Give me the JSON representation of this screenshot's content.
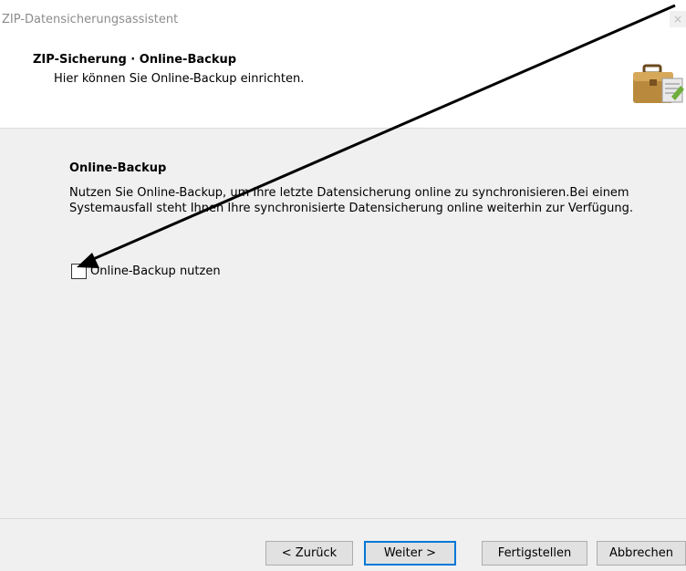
{
  "window": {
    "title": "ZIP-Datensicherungsassistent",
    "close_glyph": "×"
  },
  "header": {
    "title": "ZIP-Sicherung · Online-Backup",
    "subtitle": "Hier können Sie Online-Backup einrichten.",
    "icon": "briefcase-icon"
  },
  "content": {
    "section_heading": "Online-Backup",
    "description": "Nutzen Sie Online-Backup, um Ihre letzte Datensicherung online zu synchronisieren.Bei einem Systemausfall steht Ihnen Ihre synchronisierte Datensicherung online weiterhin zur Verfügung.",
    "checkbox": {
      "label": "Online-Backup nutzen",
      "checked": false
    }
  },
  "footer": {
    "back_label": "< Zurück",
    "next_label": "Weiter >",
    "finish_label": "Fertigstellen",
    "cancel_label": "Abbrechen"
  },
  "colors": {
    "dialog_background": "#f0f0f0",
    "header_background": "#ffffff",
    "primary_button_border": "#0078d7",
    "annotation_arrow": "#000000"
  }
}
